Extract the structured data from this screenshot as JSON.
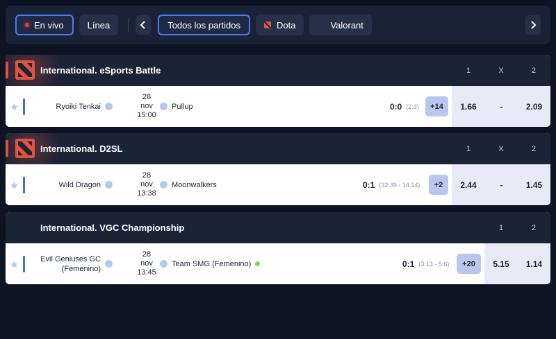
{
  "filters": {
    "live_label": "En vivo",
    "line_label": "Línea",
    "all_matches_label": "Todos los partidos",
    "dota_label": "Dota",
    "valorant_label": "Valorant"
  },
  "leagues": [
    {
      "title": "International. eSports Battle",
      "columns": [
        "1",
        "X",
        "2"
      ],
      "match": {
        "home": "Ryoiki Tenkai",
        "away": "Pullup",
        "day": "28",
        "month": "nov",
        "time": "15:00",
        "score": "0:0",
        "score_detail": "(2:3)",
        "more": "+14",
        "odds": [
          "1.66",
          "-",
          "2.09"
        ]
      }
    },
    {
      "title": "International. D2SL",
      "columns": [
        "1",
        "X",
        "2"
      ],
      "match": {
        "home": "Wild Dragon",
        "away": "Moonwalkers",
        "day": "28",
        "month": "nov",
        "time": "13:38",
        "score": "0:1",
        "score_detail": "(32:39 - 14:14)",
        "more": "+2",
        "odds": [
          "2.44",
          "-",
          "1.45"
        ]
      }
    },
    {
      "title": "International. VGC Championship",
      "columns": [
        "1",
        "2"
      ],
      "match": {
        "home_line1": "Evil Geniuses GC",
        "home_line2": "(Femenino)",
        "away": "Team SMG (Femenino)",
        "day": "28",
        "month": "nov",
        "time": "13:45",
        "score": "0:1",
        "score_detail": "(3:13 - 5:6)",
        "more": "+20",
        "odds": [
          "5.15",
          "1.14"
        ]
      }
    }
  ],
  "colors": {
    "accent": "#4d7cf0",
    "live": "#e5383b",
    "dota": "#e0533f",
    "page_bg": "#0e1424",
    "header_bg": "#1b2337"
  },
  "icons": [
    "live-dot-icon",
    "chevron-left-icon",
    "chevron-right-icon",
    "dota-icon",
    "star-icon",
    "team-icon",
    "online-status-icon"
  ]
}
